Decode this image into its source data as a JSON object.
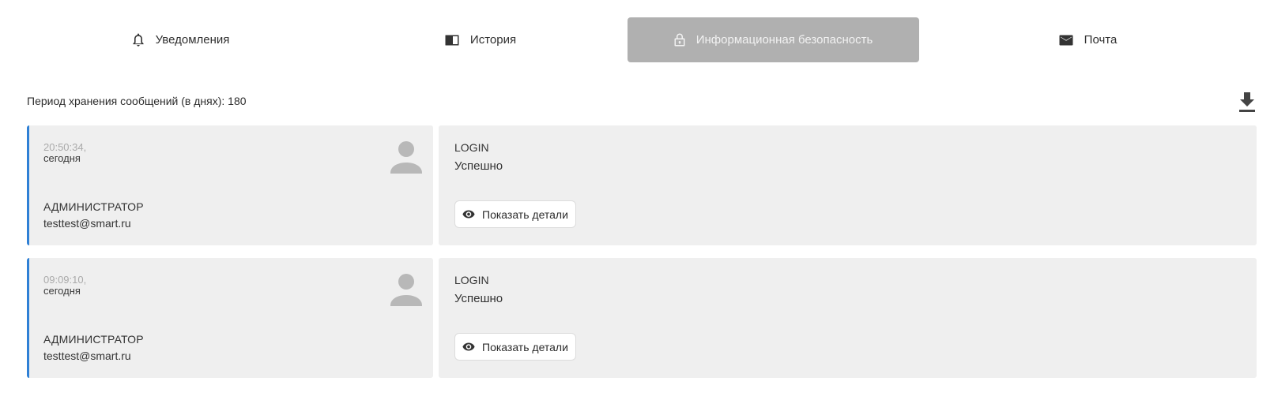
{
  "tabs": [
    {
      "label": "Уведомления",
      "icon": "bell-icon",
      "active": false
    },
    {
      "label": "История",
      "icon": "book-icon",
      "active": false
    },
    {
      "label": "Информационная безопасность",
      "icon": "lock-icon",
      "active": true
    },
    {
      "label": "Почта",
      "icon": "mail-icon",
      "active": false
    }
  ],
  "retention": {
    "label": "Период хранения сообщений (в днях): 180"
  },
  "toolbar": {
    "download_icon": "download-icon"
  },
  "colors": {
    "accent": "#2f80d5",
    "active_tab_bg": "#b0b0b0",
    "card_bg": "#efefef"
  },
  "events": [
    {
      "time": "20:50:34,",
      "day": "сегодня",
      "role": "АДМИНИСТРАТОР",
      "email": "testtest@smart.ru",
      "action": "LOGIN",
      "result": "Успешно",
      "details_label": "Показать детали"
    },
    {
      "time": "09:09:10,",
      "day": "сегодня",
      "role": "АДМИНИСТРАТОР",
      "email": "testtest@smart.ru",
      "action": "LOGIN",
      "result": "Успешно",
      "details_label": "Показать детали"
    }
  ]
}
